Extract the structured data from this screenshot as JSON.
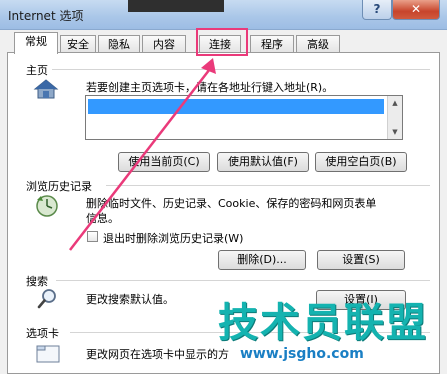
{
  "window": {
    "title": "Internet 选项",
    "help_label": "?",
    "close_label": "✕"
  },
  "tabs": [
    {
      "label": "常规",
      "active": true
    },
    {
      "label": "安全",
      "active": false
    },
    {
      "label": "隐私",
      "active": false
    },
    {
      "label": "内容",
      "active": false
    },
    {
      "label": "连接",
      "active": false,
      "highlighted": true
    },
    {
      "label": "程序",
      "active": false
    },
    {
      "label": "高级",
      "active": false
    }
  ],
  "homepage": {
    "section_label": "主页",
    "instruction": "若要创建主页选项卡，请在各地址行键入地址(R)。",
    "url_value": "",
    "buttons": {
      "use_current": "使用当前页(C)",
      "use_default": "使用默认值(F)",
      "use_blank": "使用空白页(B)"
    }
  },
  "history": {
    "section_label": "浏览历史记录",
    "description_line1": "删除临时文件、历史记录、Cookie、保存的密码和网页表单",
    "description_line2": "信息。",
    "checkbox_label": "退出时删除浏览历史记录(W)",
    "checkbox_checked": false,
    "delete_button": "删除(D)...",
    "settings_button": "设置(S)"
  },
  "search": {
    "section_label": "搜索",
    "description": "更改搜索默认值。",
    "settings_button": "设置(I)"
  },
  "tabs_section": {
    "section_label": "选项卡",
    "description": "更改网页在选项卡中显示的方"
  },
  "watermark": {
    "brand": "技术员联盟",
    "url": "www.jsgho.com",
    "color": "#14b3b0"
  },
  "annotation": {
    "highlight_color": "#ea3a7a"
  },
  "icons": {
    "home": "home-icon",
    "history": "history-icon",
    "search": "search-icon",
    "tabs": "tabs-icon"
  }
}
